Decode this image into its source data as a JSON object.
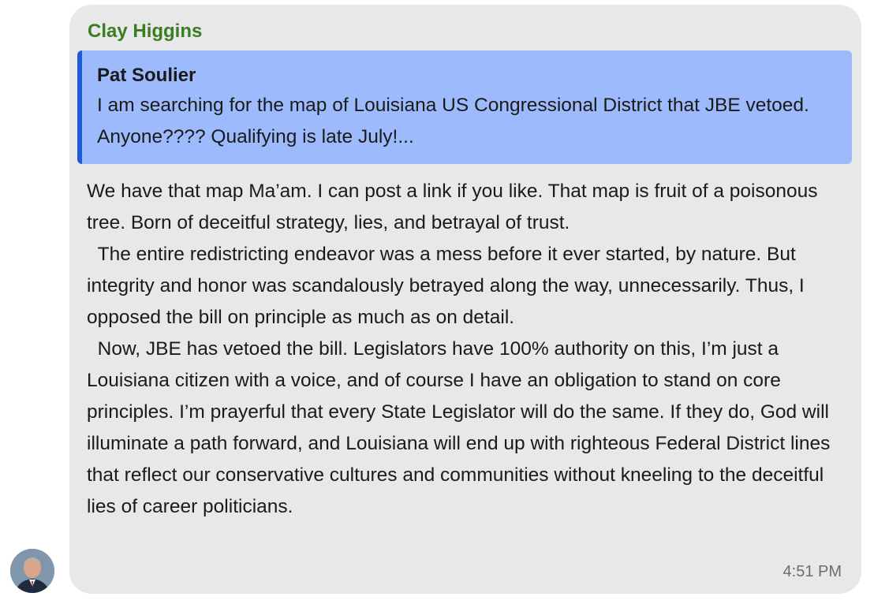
{
  "message": {
    "sender": "Clay Higgins",
    "reply_to": {
      "author": "Pat Soulier",
      "text": "I am searching for the map of Louisiana US Congressional District that JBE vetoed.  Anyone????   Qualifying is late July!..."
    },
    "body": "We have that map Ma’am. I can post a link if you like. That map is fruit of a poisonous tree. Born of deceitful strategy, lies, and betrayal of trust.\n  The entire redistricting endeavor was a mess before it ever started, by nature. But integrity and honor was scandalously betrayed along the way, unnecessarily. Thus, I opposed the bill on principle as much as on detail.\n  Now, JBE has vetoed the bill. Legislators have 100% authority on this, I’m just a Louisiana citizen with a voice, and of course I have an obligation to stand on core principles. I’m prayerful that every State Legislator will do the same. If they do, God will illuminate a path forward, and Louisiana will end up with righteous Federal District lines that reflect our conservative cultures and communities without kneeling to the deceitful lies of career politicians.",
    "time": "4:51 PM"
  },
  "colors": {
    "bubble_bg": "#e8e8e8",
    "sender_name": "#3a7d22",
    "quote_bg": "#9dbbfc",
    "quote_bar": "#1f5bd8",
    "timestamp": "#6e6e6e"
  },
  "icons": {
    "avatar": "sender-avatar-photo"
  }
}
